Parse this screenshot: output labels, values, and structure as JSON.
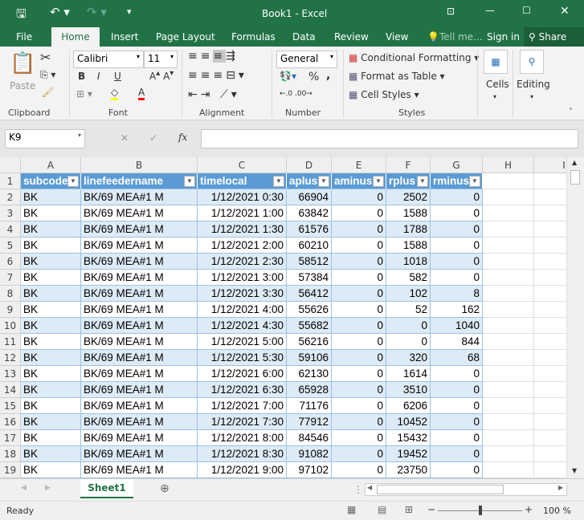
{
  "window": {
    "title": "Book1 - Excel"
  },
  "ribbon_tabs": [
    "File",
    "Home",
    "Insert",
    "Page Layout",
    "Formulas",
    "Data",
    "Review",
    "View"
  ],
  "tell_me": "Tell me...",
  "sign_in": "Sign in",
  "share": "Share",
  "ribbon": {
    "clipboard": {
      "paste": "Paste",
      "label": "Clipboard"
    },
    "font": {
      "name": "Calibri",
      "size": "11",
      "bold": "B",
      "italic": "I",
      "underline": "U",
      "label": "Font",
      "fill_color": "#ffff00",
      "font_color": "#ff0000"
    },
    "alignment": {
      "label": "Alignment"
    },
    "number": {
      "format": "General",
      "percent": "%",
      "comma": ",",
      "label": "Number"
    },
    "styles": {
      "conditional": "Conditional Formatting",
      "format_table": "Format as Table",
      "cell_styles": "Cell Styles",
      "label": "Styles"
    },
    "cells": "Cells",
    "editing": "Editing"
  },
  "formula_bar": {
    "name_box": "K9",
    "fx": "fx",
    "value": ""
  },
  "columns": [
    "A",
    "B",
    "C",
    "D",
    "E",
    "F",
    "G",
    "H",
    "I"
  ],
  "table": {
    "headers": [
      "subcode",
      "linefeedername",
      "timelocal",
      "aplus",
      "aminus",
      "rplus",
      "rminus"
    ],
    "rows": [
      [
        "BK",
        "BK/69 MEA#1 M",
        "1/12/2021 0:30",
        "66904",
        "0",
        "2502",
        "0"
      ],
      [
        "BK",
        "BK/69 MEA#1 M",
        "1/12/2021 1:00",
        "63842",
        "0",
        "1588",
        "0"
      ],
      [
        "BK",
        "BK/69 MEA#1 M",
        "1/12/2021 1:30",
        "61576",
        "0",
        "1788",
        "0"
      ],
      [
        "BK",
        "BK/69 MEA#1 M",
        "1/12/2021 2:00",
        "60210",
        "0",
        "1588",
        "0"
      ],
      [
        "BK",
        "BK/69 MEA#1 M",
        "1/12/2021 2:30",
        "58512",
        "0",
        "1018",
        "0"
      ],
      [
        "BK",
        "BK/69 MEA#1 M",
        "1/12/2021 3:00",
        "57384",
        "0",
        "582",
        "0"
      ],
      [
        "BK",
        "BK/69 MEA#1 M",
        "1/12/2021 3:30",
        "56412",
        "0",
        "102",
        "8"
      ],
      [
        "BK",
        "BK/69 MEA#1 M",
        "1/12/2021 4:00",
        "55626",
        "0",
        "52",
        "162"
      ],
      [
        "BK",
        "BK/69 MEA#1 M",
        "1/12/2021 4:30",
        "55682",
        "0",
        "0",
        "1040"
      ],
      [
        "BK",
        "BK/69 MEA#1 M",
        "1/12/2021 5:00",
        "56216",
        "0",
        "0",
        "844"
      ],
      [
        "BK",
        "BK/69 MEA#1 M",
        "1/12/2021 5:30",
        "59106",
        "0",
        "320",
        "68"
      ],
      [
        "BK",
        "BK/69 MEA#1 M",
        "1/12/2021 6:00",
        "62130",
        "0",
        "1614",
        "0"
      ],
      [
        "BK",
        "BK/69 MEA#1 M",
        "1/12/2021 6:30",
        "65928",
        "0",
        "3510",
        "0"
      ],
      [
        "BK",
        "BK/69 MEA#1 M",
        "1/12/2021 7:00",
        "71176",
        "0",
        "6206",
        "0"
      ],
      [
        "BK",
        "BK/69 MEA#1 M",
        "1/12/2021 7:30",
        "77912",
        "0",
        "10452",
        "0"
      ],
      [
        "BK",
        "BK/69 MEA#1 M",
        "1/12/2021 8:00",
        "84546",
        "0",
        "15432",
        "0"
      ],
      [
        "BK",
        "BK/69 MEA#1 M",
        "1/12/2021 8:30",
        "91082",
        "0",
        "19452",
        "0"
      ],
      [
        "BK",
        "BK/69 MEA#1 M",
        "1/12/2021 9:00",
        "97102",
        "0",
        "23750",
        "0"
      ]
    ]
  },
  "sheet_tab": "Sheet1",
  "status": {
    "text": "Ready",
    "zoom": "100 %"
  }
}
